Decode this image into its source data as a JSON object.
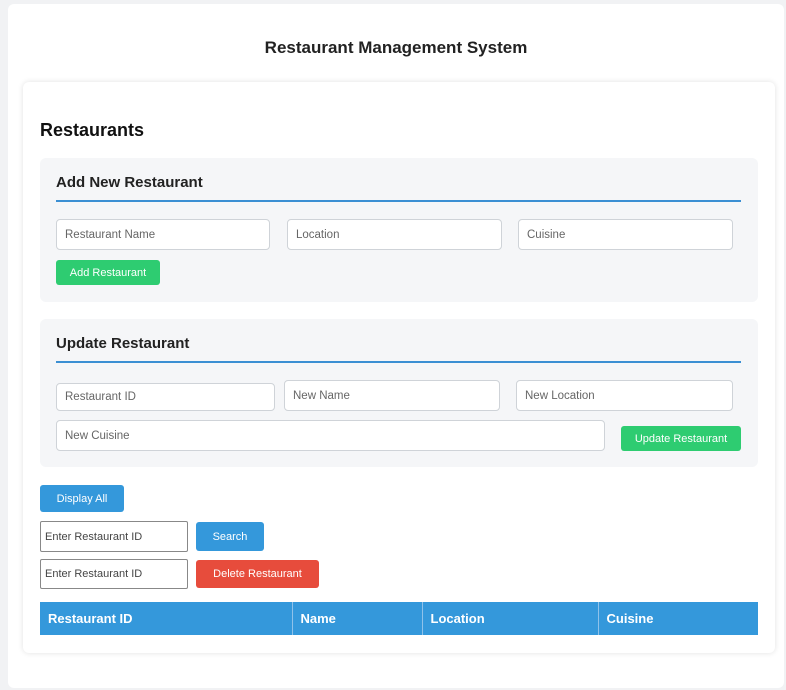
{
  "app": {
    "title": "Restaurant Management System"
  },
  "restaurants": {
    "heading": "Restaurants",
    "add_panel": {
      "heading": "Add New Restaurant",
      "name_placeholder": "Restaurant Name",
      "location_placeholder": "Location",
      "cuisine_placeholder": "Cuisine",
      "submit_label": "Add Restaurant"
    },
    "update_panel": {
      "heading": "Update Restaurant",
      "id_placeholder": "Restaurant ID",
      "new_name_placeholder": "New Name",
      "new_location_placeholder": "New Location",
      "new_cuisine_placeholder": "New Cuisine",
      "submit_label": "Update Restaurant"
    },
    "display_all_label": "Display All",
    "search": {
      "placeholder": "Enter Restaurant ID",
      "button_label": "Search"
    },
    "delete": {
      "placeholder": "Enter Restaurant ID",
      "button_label": "Delete Restaurant"
    },
    "table": {
      "columns": [
        "Restaurant ID",
        "Name",
        "Location",
        "Cuisine"
      ],
      "rows": []
    }
  },
  "colors": {
    "accent_blue": "#3498db",
    "success_green": "#2ecc71",
    "danger_red": "#e74c3c"
  }
}
